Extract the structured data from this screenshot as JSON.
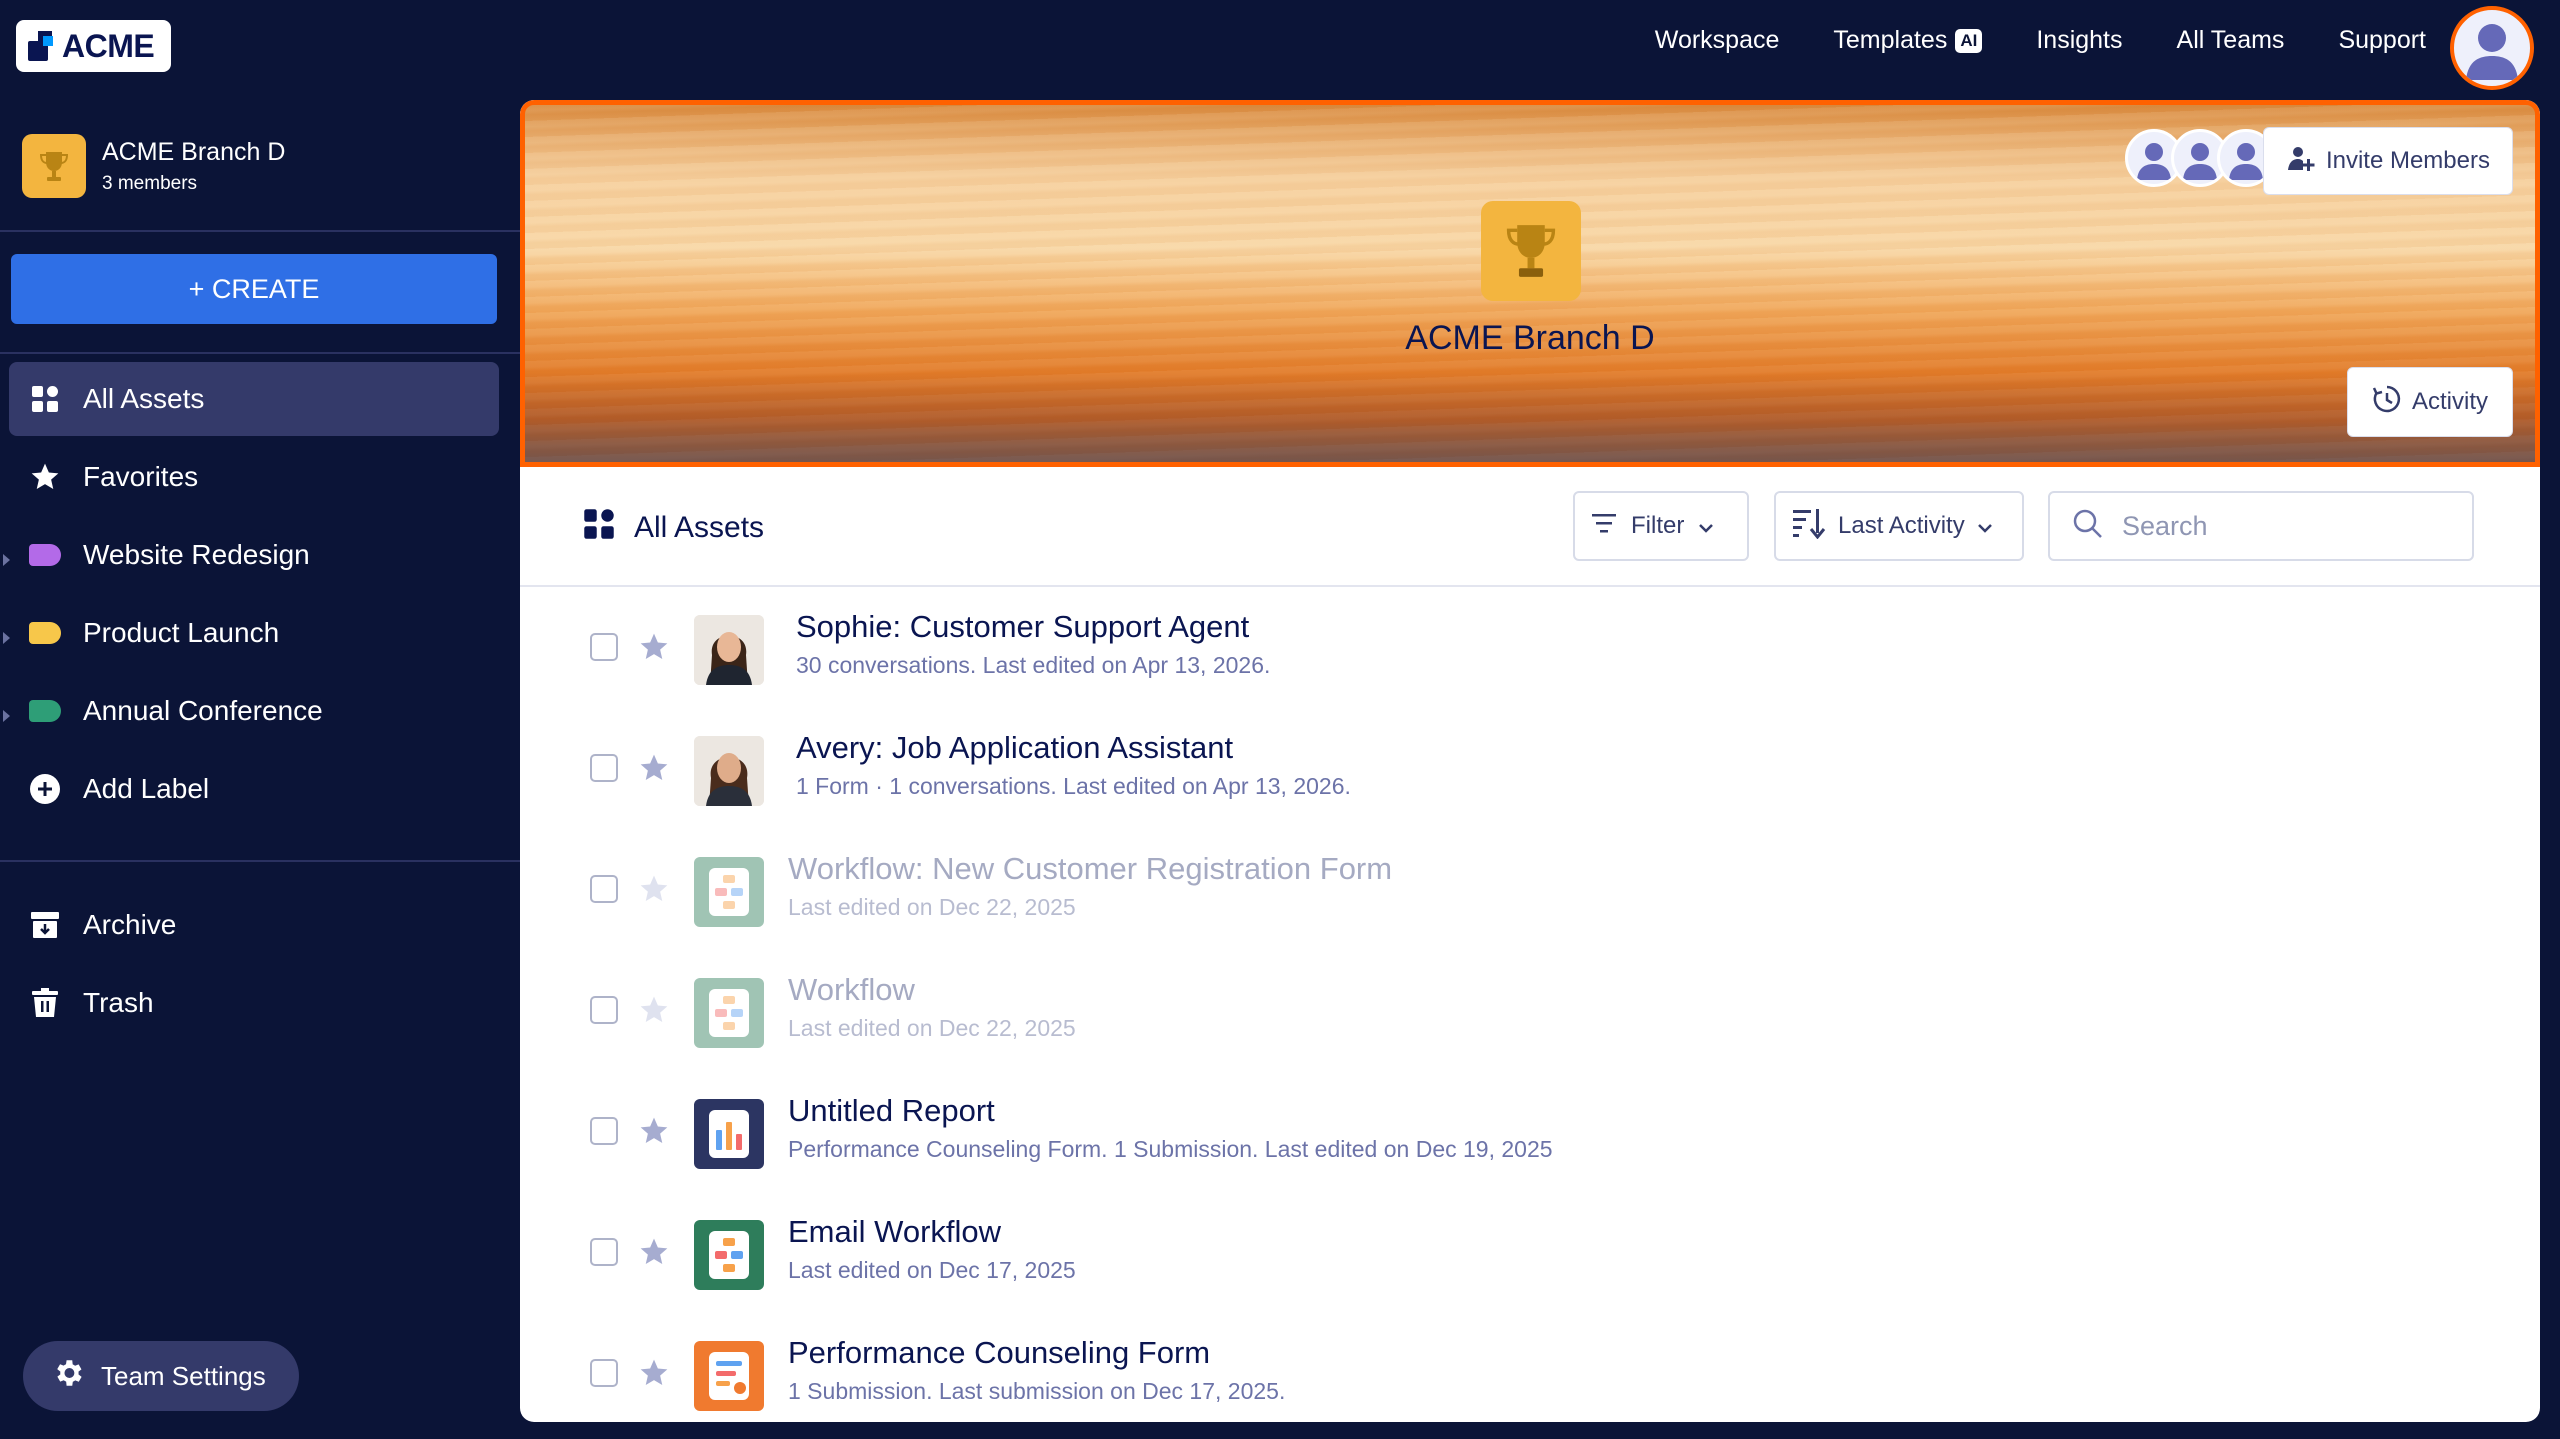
{
  "brand": {
    "logo_text": "ACME"
  },
  "topnav": {
    "workspace": "Workspace",
    "templates": "Templates",
    "templates_badge": "AI",
    "insights": "Insights",
    "all_teams": "All Teams",
    "support": "Support"
  },
  "sidebar": {
    "team_name": "ACME Branch D",
    "team_members": "3 members",
    "create_label": "+ CREATE",
    "items": [
      {
        "label": "All Assets",
        "icon": "grid-icon"
      },
      {
        "label": "Favorites",
        "icon": "star-icon"
      },
      {
        "label": "Website Redesign",
        "icon": "label-tag-icon",
        "color": "#b36ae8"
      },
      {
        "label": "Product Launch",
        "icon": "label-tag-icon",
        "color": "#f7c74a"
      },
      {
        "label": "Annual Conference",
        "icon": "label-tag-icon",
        "color": "#2e9e77"
      },
      {
        "label": "Add Label",
        "icon": "plus-circle-icon"
      },
      {
        "label": "Archive",
        "icon": "archive-icon"
      },
      {
        "label": "Trash",
        "icon": "trash-icon"
      }
    ],
    "team_settings": "Team Settings"
  },
  "banner": {
    "title": "ACME Branch D",
    "invite_label": "Invite Members",
    "activity_label": "Activity"
  },
  "toolbar": {
    "title": "All Assets",
    "filter_label": "Filter",
    "sort_label": "Last Activity",
    "search_placeholder": "Search"
  },
  "assets": [
    {
      "title": "Sophie: Customer Support Agent",
      "subtitle": "30 conversations. Last edited on Apr 13, 2026.",
      "type": "agent",
      "dimmed": false
    },
    {
      "title": "Avery: Job Application Assistant",
      "subtitle": "1 Form · 1 conversations. Last edited on Apr 13, 2026.",
      "type": "agent",
      "dimmed": false
    },
    {
      "title": "Workflow: New Customer Registration Form",
      "subtitle": "Last edited on Dec 22, 2025",
      "type": "workflow",
      "dimmed": true
    },
    {
      "title": "Workflow",
      "subtitle": "Last edited on Dec 22, 2025",
      "type": "workflow",
      "dimmed": true
    },
    {
      "title": "Untitled Report",
      "subtitle": "Performance Counseling Form. 1 Submission. Last edited on Dec 19, 2025",
      "type": "report",
      "dimmed": false
    },
    {
      "title": "Email Workflow",
      "subtitle": "Last edited on Dec 17, 2025",
      "type": "workflow",
      "dimmed": false
    },
    {
      "title": "Performance Counseling Form",
      "subtitle": "1 Submission.  Last submission on Dec 17, 2025.",
      "type": "form",
      "dimmed": false
    }
  ],
  "colors": {
    "accent_orange": "#ff6100",
    "create_blue": "#2f6fe6",
    "navy": "#0b1437",
    "trophy_gold": "#f3b53f"
  }
}
